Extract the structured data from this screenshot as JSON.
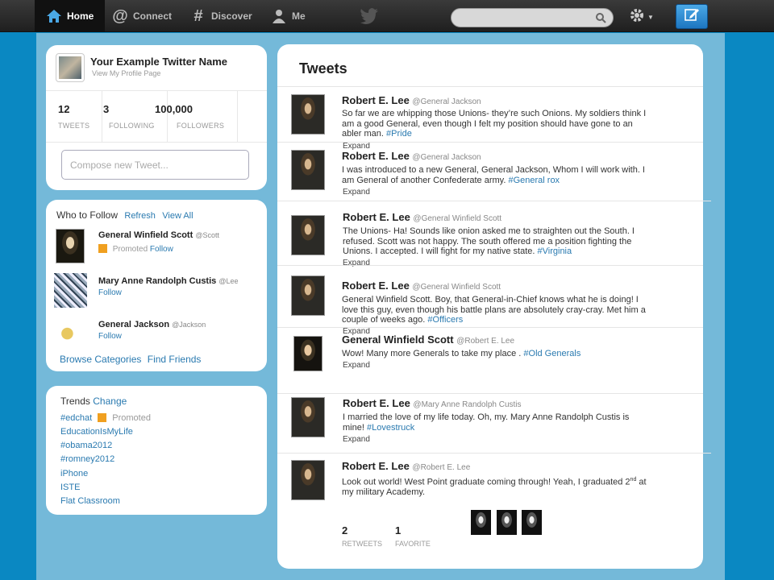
{
  "nav": {
    "home": "Home",
    "connect": "Connect",
    "discover": "Discover",
    "me": "Me"
  },
  "profile": {
    "name": "Your Example  Twitter Name",
    "link": "View My Profile Page",
    "stats": [
      {
        "num": "12",
        "label": "TWEETS"
      },
      {
        "num": "3",
        "label": "FOLLOWING"
      },
      {
        "num": "100,000",
        "label": "FOLLOWERS"
      }
    ],
    "compose_placeholder": "Compose new Tweet..."
  },
  "who_to_follow": {
    "title": "Who to Follow",
    "refresh": "Refresh",
    "view_all": "View All",
    "items": [
      {
        "name": "General Winfield  Scott",
        "handle": "@Scott",
        "promoted": "Promoted",
        "follow": "Follow"
      },
      {
        "name": "Mary Anne  Randolph Custis",
        "handle": "@Lee",
        "follow": "Follow"
      },
      {
        "name": "General Jackson",
        "handle": "@Jackson",
        "follow": "Follow"
      }
    ],
    "browse": "Browse Categories",
    "find": "Find Friends"
  },
  "trends": {
    "title": "Trends",
    "change": "Change",
    "items": [
      "#edchat",
      "EducationIsMyLife",
      "#obama2012",
      "#romney2012",
      "iPhone",
      "ISTE",
      "Flat Classroom"
    ],
    "promoted": "Promoted"
  },
  "tweets": {
    "title": "Tweets",
    "expand": "Expand",
    "items": [
      {
        "name": "Robert E. Lee",
        "handle": "@General Jackson",
        "text": "So far we are whipping those Unions- they’re such Onions. My soldiers think I am a good General, even though I felt my position should have gone to an abler man.",
        "tag": "#Pride"
      },
      {
        "name": "Robert E. Lee",
        "handle": "@General Jackson",
        "text": "I was introduced to a new General, General Jackson, Whom I  will work with. I am General of another Confederate army.",
        "tag": "#General rox"
      },
      {
        "name": "Robert E. Lee",
        "handle": "@General Winfield Scott",
        "text": "The Unions- Ha! Sounds like onion asked me to straighten out the South. I refused. Scott was not happy. The south offered me a position fighting the Unions. I accepted. I will fight for my native state.",
        "tag": "#Virginia"
      },
      {
        "name": "Robert E. Lee",
        "handle": "@General Winfield Scott",
        "text": "General Winfield Scott. Boy, that General-in-Chief knows what he is doing! I love this guy, even though his battle plans are absolutely cray-cray. Met him a couple of weeks ago.",
        "tag": "#Officers"
      },
      {
        "name": "General Winfield Scott",
        "handle": "@Robert E. Lee",
        "text": "Wow! Many more Generals to take my place .",
        "tag": "#Old Generals"
      },
      {
        "name": "Robert E. Lee",
        "handle": "@Mary Anne Randolph Custis",
        "text": "I married the love of my life today. Oh, my. Mary Anne Randolph Custis is mine!",
        "tag": "#Lovestruck"
      },
      {
        "name": "Robert E. Lee",
        "handle": "@Robert E. Lee",
        "text_pre": "Look out world! West Point graduate coming through! Yeah, I graduated 2",
        "text_sup": "nd",
        "text_post": " at my military Academy."
      }
    ],
    "retweets": {
      "num": "2",
      "label": "RETWEETS"
    },
    "favorites": {
      "num": "1",
      "label": "FAVORITE"
    }
  }
}
